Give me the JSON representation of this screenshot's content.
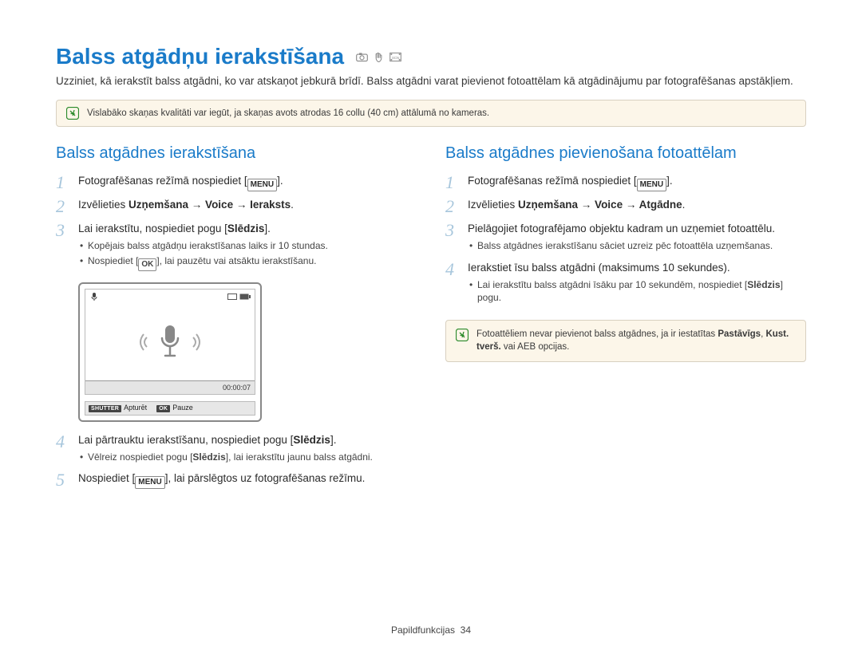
{
  "page_title": "Balss atgādņu ierakstīšana",
  "intro": "Uzziniet, kā ierakstīt balss atgādni, ko var atskaņot jebkurā brīdī. Balss atgādni varat pievienot fotoattēlam kā atgādinājumu par fotografēšanas apstākļiem.",
  "top_note": "Vislabāko skaņas kvalitāti var iegūt, ja skaņas avots atrodas 16 collu (40 cm) attālumā no kameras.",
  "left": {
    "heading": "Balss atgādnes ierakstīšana",
    "steps": {
      "s1_a": "Fotografēšanas režīmā nospiediet [",
      "s1_btn": "MENU",
      "s1_b": "].",
      "s2_a": "Izvēlieties ",
      "s2_b": "Uzņemšana → Voice → Ieraksts",
      "s2_c": ".",
      "s3_a": "Lai ierakstītu, nospiediet pogu [",
      "s3_b": "Slēdzis",
      "s3_c": "].",
      "s3_sub1": "Kopējais balss atgādņu ierakstīšanas laiks ir 10 stundas.",
      "s3_sub2_a": "Nospiediet [",
      "s3_sub2_btn": "OK",
      "s3_sub2_b": "], lai pauzētu vai atsāktu ierakstīšanu.",
      "s4_a": "Lai pārtrauktu ierakstīšanu, nospiediet pogu [",
      "s4_b": "Slēdzis",
      "s4_c": "].",
      "s4_sub_a": "Vēlreiz nospiediet pogu [",
      "s4_sub_b": "Slēdzis",
      "s4_sub_c": "], lai ierakstītu jaunu balss atgādni.",
      "s5_a": "Nospiediet [",
      "s5_btn": "MENU",
      "s5_b": "], lai pārslēgtos uz fotografēšanas režīmu."
    },
    "diagram": {
      "timer": "00:00:07",
      "shutter_label": "SHUTTER",
      "shutter_text": "Apturēt",
      "ok_label": "OK",
      "ok_text": "Pauze"
    }
  },
  "right": {
    "heading": "Balss atgādnes pievienošana fotoattēlam",
    "steps": {
      "s1_a": "Fotografēšanas režīmā nospiediet [",
      "s1_btn": "MENU",
      "s1_b": "].",
      "s2_a": "Izvēlieties ",
      "s2_b": "Uzņemšana → Voice → Atgādne",
      "s2_c": ".",
      "s3": "Pielāgojiet fotografējamo objektu kadram un uzņemiet fotoattēlu.",
      "s3_sub": "Balss atgādnes ierakstīšanu sāciet uzreiz pēc fotoattēla uzņemšanas.",
      "s4": "Ierakstiet īsu balss atgādni (maksimums 10 sekundes).",
      "s4_sub_a": "Lai ierakstītu balss atgādni īsāku par 10 sekundēm, nospiediet [",
      "s4_sub_b": "Slēdzis",
      "s4_sub_c": "] pogu."
    },
    "note_a": "Fotoattēliem nevar pievienot balss atgādnes, ja ir iestatītas ",
    "note_b1": "Pastāvīgs",
    "note_mid": ", ",
    "note_b2": "Kust. tverš.",
    "note_c": " vai AEB opcijas."
  },
  "footer_label": "Papildfunkcijas",
  "footer_page": "34"
}
